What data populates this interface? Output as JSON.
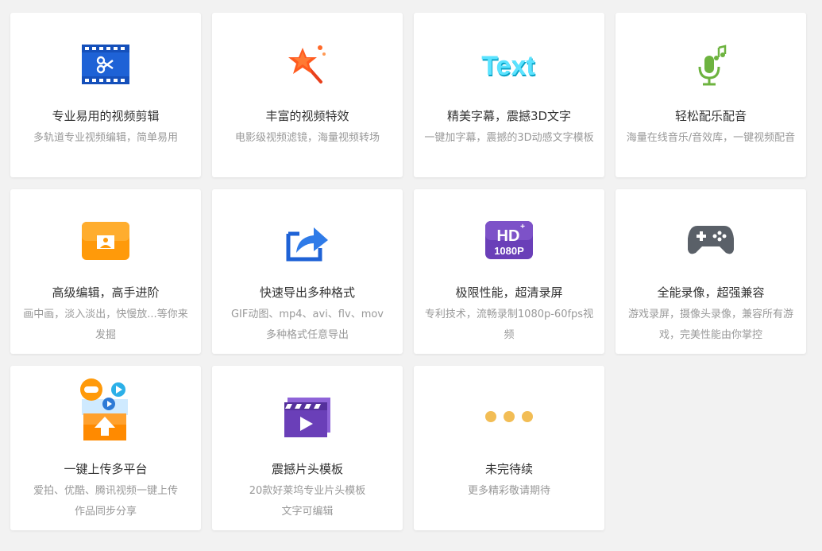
{
  "features": [
    {
      "icon": "film-scissors-icon",
      "title": "专业易用的视频剪辑",
      "desc": [
        "多轨道专业视频编辑，简单易用"
      ]
    },
    {
      "icon": "magic-star-wand-icon",
      "title": "丰富的视频特效",
      "desc": [
        "电影级视频滤镜，海量视频转场"
      ]
    },
    {
      "icon": "text-effect-icon",
      "icon_text": "Text",
      "title": "精美字幕，震撼3D文字",
      "desc": [
        "一键加字幕，震撼的3D动感文字模板"
      ]
    },
    {
      "icon": "microphone-music-icon",
      "title": "轻松配乐配音",
      "desc": [
        "海量在线音乐/音效库，一键视频配音"
      ]
    },
    {
      "icon": "picture-in-picture-icon",
      "title": "高级编辑，高手进阶",
      "desc": [
        "画中画，淡入淡出，快慢放...等你来",
        "发掘"
      ]
    },
    {
      "icon": "export-share-icon",
      "title": "快速导出多种格式",
      "desc": [
        "GIF动图、mp4、avi、flv、mov",
        "多种格式任意导出"
      ]
    },
    {
      "icon": "hd-1080p-icon",
      "icon_text": "HD",
      "icon_sub": "1080P",
      "title": "极限性能，超清录屏",
      "desc": [
        "专利技术，流畅录制1080p-60fps视",
        "频"
      ]
    },
    {
      "icon": "gamepad-icon",
      "title": "全能录像，超强兼容",
      "desc": [
        "游戏录屏，摄像头录像，兼容所有游",
        "戏，完美性能由你掌控"
      ]
    },
    {
      "icon": "cloud-upload-platforms-icon",
      "title": "一键上传多平台",
      "desc": [
        "爱拍、优酷、腾讯视频一键上传",
        "作品同步分享"
      ]
    },
    {
      "icon": "clapperboard-icon",
      "title": "震撼片头模板",
      "desc": [
        "20款好莱坞专业片头模板",
        "文字可编辑"
      ]
    },
    {
      "icon": "more-dots-icon",
      "title": "未完待续",
      "desc": [
        "更多精彩敬请期待"
      ]
    }
  ],
  "colors": {
    "page_bg": "#f2f2f2",
    "card_bg": "#ffffff",
    "title_text": "#333333",
    "desc_text": "#999999",
    "blue": "#1e62d6",
    "orange": "#ff8a00",
    "purple": "#6a3fb8",
    "green": "#6db33f",
    "dot": "#f2bd55"
  }
}
